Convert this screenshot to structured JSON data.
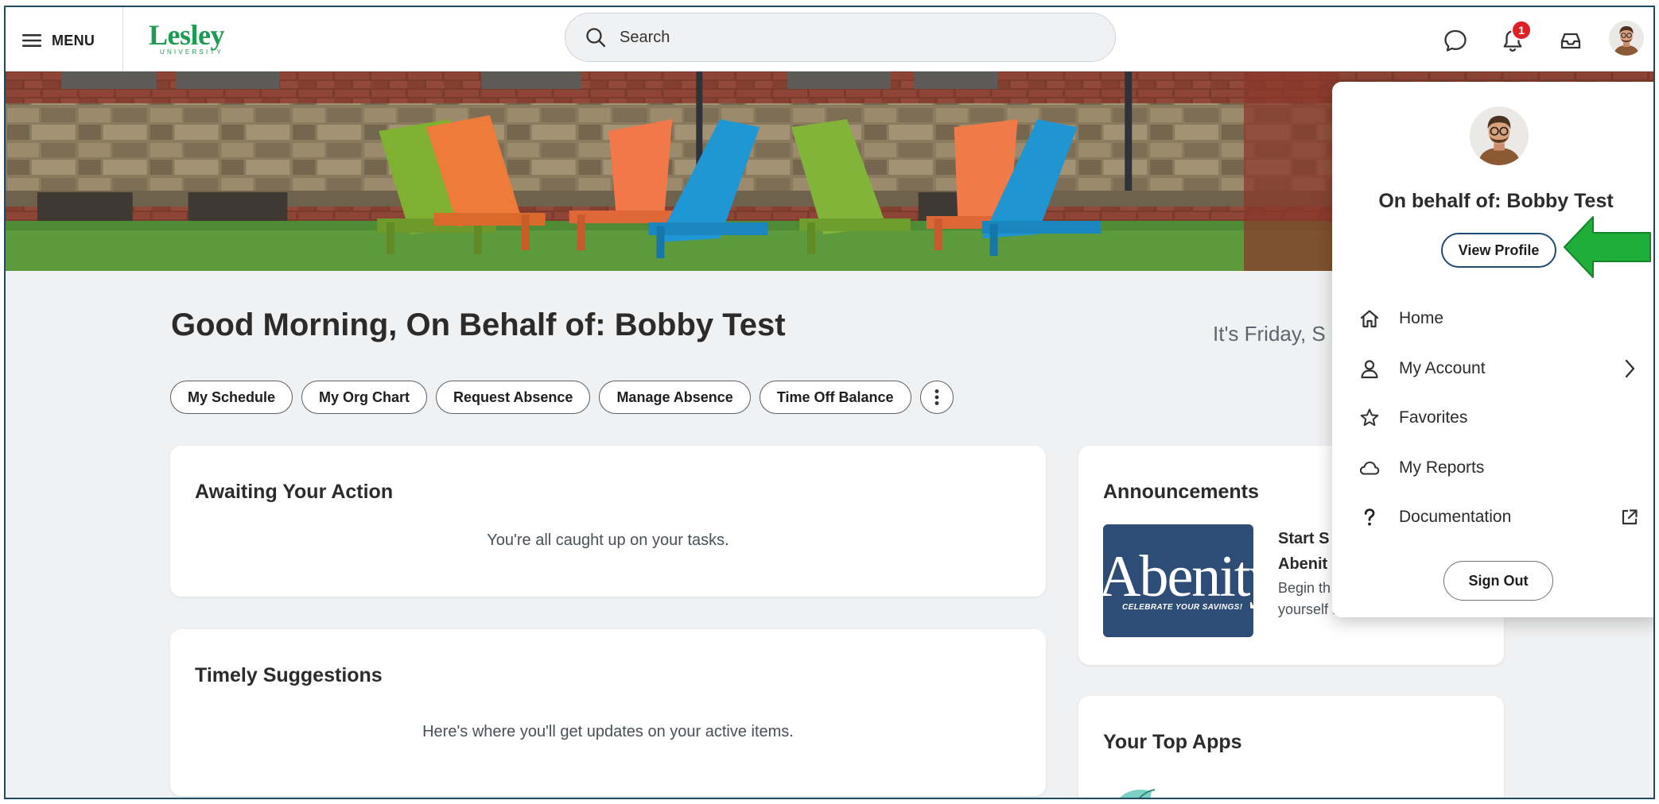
{
  "header": {
    "menu_label": "MENU",
    "logo_text": "Lesley",
    "logo_subtext": "UNIVERSITY",
    "search_placeholder": "Search",
    "notification_count": "1",
    "icons": [
      "hamburger-icon",
      "search-icon",
      "chat-icon",
      "bell-icon",
      "inbox-icon"
    ]
  },
  "greeting": "Good Morning, On Behalf of: Bobby Test",
  "date_text": "It's Friday, S",
  "quick_actions": [
    "My Schedule",
    "My Org Chart",
    "Request Absence",
    "Manage Absence",
    "Time Off Balance"
  ],
  "awaiting": {
    "title": "Awaiting Your Action",
    "message": "You're all caught up on your tasks."
  },
  "suggestions": {
    "title": "Timely Suggestions",
    "message": "Here's where you'll get updates on your active items."
  },
  "announcements": {
    "title": "Announcements",
    "image_word": "Abenity",
    "image_tagline": "CELEBRATE YOUR SAVINGS!",
    "item_title": "Start S… Abenit…",
    "item_title_line1": "Start S",
    "item_title_line2": "Abenit",
    "item_body_line1": "Begin th",
    "item_body_line2": "yourself first. Explore these..."
  },
  "top_apps": {
    "title": "Your Top Apps"
  },
  "profile_menu": {
    "name": "On behalf of: Bobby Test",
    "view_profile": "View Profile",
    "items": [
      {
        "label": "Home",
        "icon": "home-icon"
      },
      {
        "label": "My Account",
        "icon": "user-icon",
        "trailing": "chevron-right-icon"
      },
      {
        "label": "Favorites",
        "icon": "star-icon"
      },
      {
        "label": "My Reports",
        "icon": "cloud-icon"
      },
      {
        "label": "Documentation",
        "icon": "question-icon",
        "trailing": "external-link-icon"
      }
    ],
    "sign_out": "Sign Out"
  },
  "colors": {
    "brand_green": "#1f9b53",
    "badge_red": "#de1f26",
    "border_navy": "#1f4a63",
    "annotation_arrow": "#1fae3a",
    "abenity_blue": "#2d4d76"
  }
}
